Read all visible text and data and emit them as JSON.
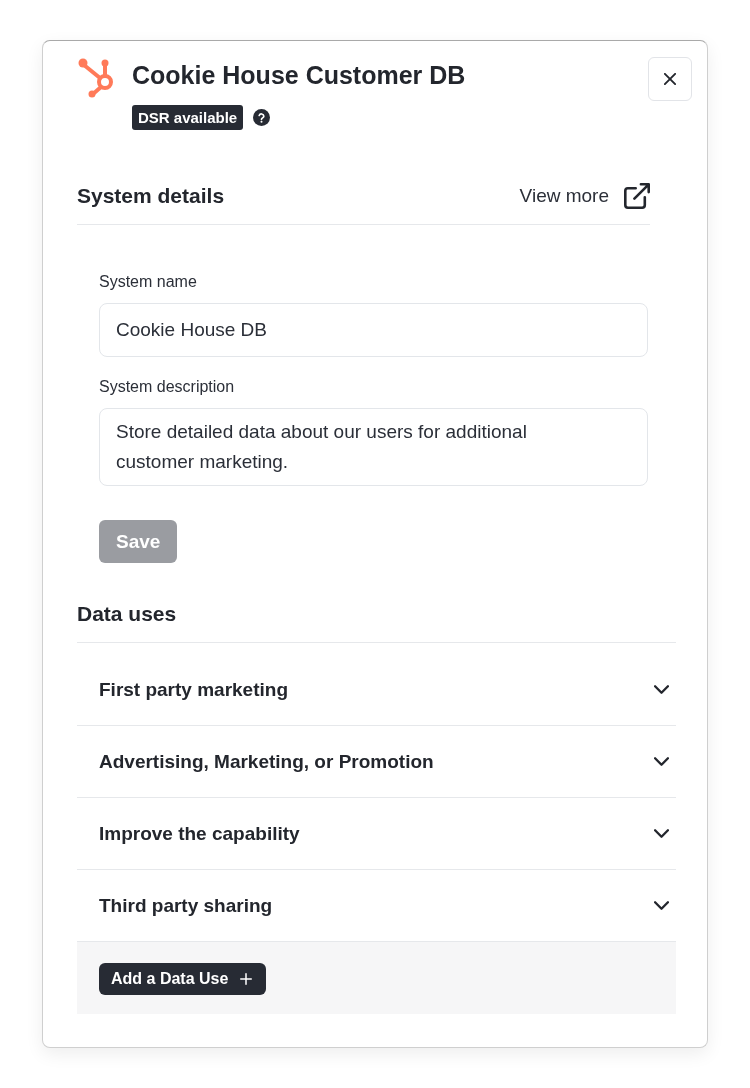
{
  "dialog": {
    "title": "Cookie House Customer DB",
    "badge": "DSR available"
  },
  "system_details": {
    "heading": "System details",
    "view_more": "View more",
    "fields": [
      {
        "kind": "input",
        "label": "System name",
        "value": "Cookie House DB"
      },
      {
        "kind": "textarea",
        "label": "System description",
        "value": "Store detailed data about our users for additional customer marketing."
      }
    ],
    "save_button": {
      "label": "Save",
      "disabled": true
    }
  },
  "data_uses": {
    "heading": "Data uses",
    "items": [
      {
        "label": "First party marketing",
        "expanded": false
      },
      {
        "label": "Advertising, Marketing, or Promotion",
        "expanded": false
      },
      {
        "label": "Improve the capability",
        "expanded": false
      },
      {
        "label": "Third party sharing",
        "expanded": false
      }
    ],
    "add_button": "Add a Data Use"
  }
}
